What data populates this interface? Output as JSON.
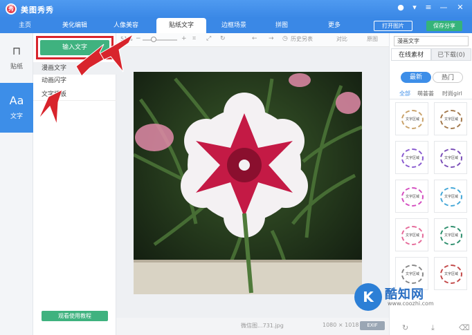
{
  "app": {
    "title": "美图秀秀",
    "logo_text": "秀"
  },
  "window_controls": {
    "chat": "●",
    "wifi": "▾",
    "menu": "≡",
    "minimize": "—",
    "close": "✕"
  },
  "nav_tabs": [
    {
      "label": "主页"
    },
    {
      "label": "美化编辑"
    },
    {
      "label": "人像美容"
    },
    {
      "label": "贴纸文字"
    },
    {
      "label": "边框场景"
    },
    {
      "label": "拼图"
    },
    {
      "label": "更多"
    }
  ],
  "header_buttons": {
    "open_image": "打开图片",
    "save_share": "保存分享"
  },
  "left_nav": [
    {
      "label": "贴纸",
      "icon": "bookmark-icon",
      "glyph": "⊓"
    },
    {
      "label": "文字",
      "icon": "text-aa-icon",
      "glyph": "Aa"
    }
  ],
  "sub_panel": {
    "input_button": "输入文字",
    "items": [
      {
        "label": "漫画文字"
      },
      {
        "label": "动画闪字"
      },
      {
        "label": "文字模板"
      }
    ],
    "tutorial_button": "观看使用教程"
  },
  "toolbar": {
    "zoom": "51%",
    "minus": "−",
    "plus": "+",
    "history": "历史另表",
    "compare": "对比",
    "original": "原图"
  },
  "status": {
    "filename": "微信图...731.jpg",
    "dimensions": "1080 × 1018",
    "exif": "EXIF"
  },
  "right_panel": {
    "category": "漫画文字",
    "tabs": [
      {
        "label": "在线素材"
      },
      {
        "label": "已下载(0)"
      }
    ],
    "sort": [
      {
        "label": "最新"
      },
      {
        "label": "热门"
      }
    ],
    "filters": [
      {
        "label": "全部"
      },
      {
        "label": "萌荟荟"
      },
      {
        "label": "时尚girl"
      }
    ],
    "thumb_caption": "文字区域",
    "thumbs": [
      {
        "color": "#c9a26a"
      },
      {
        "color": "#a47a4e"
      },
      {
        "color": "#8a5bd0"
      },
      {
        "color": "#7b4fb8"
      },
      {
        "color": "#d44fc0"
      },
      {
        "color": "#46a8d8"
      },
      {
        "color": "#e56b9a"
      },
      {
        "color": "#2f8f6e"
      },
      {
        "color": "#888888"
      },
      {
        "color": "#c34a4a"
      }
    ]
  },
  "watermark": {
    "logo": "K",
    "name": "酷知网",
    "url": "www.coozhi.com"
  },
  "colors": {
    "accent": "#3a88e6",
    "green": "#3fb27f",
    "highlight": "#d8242c"
  }
}
